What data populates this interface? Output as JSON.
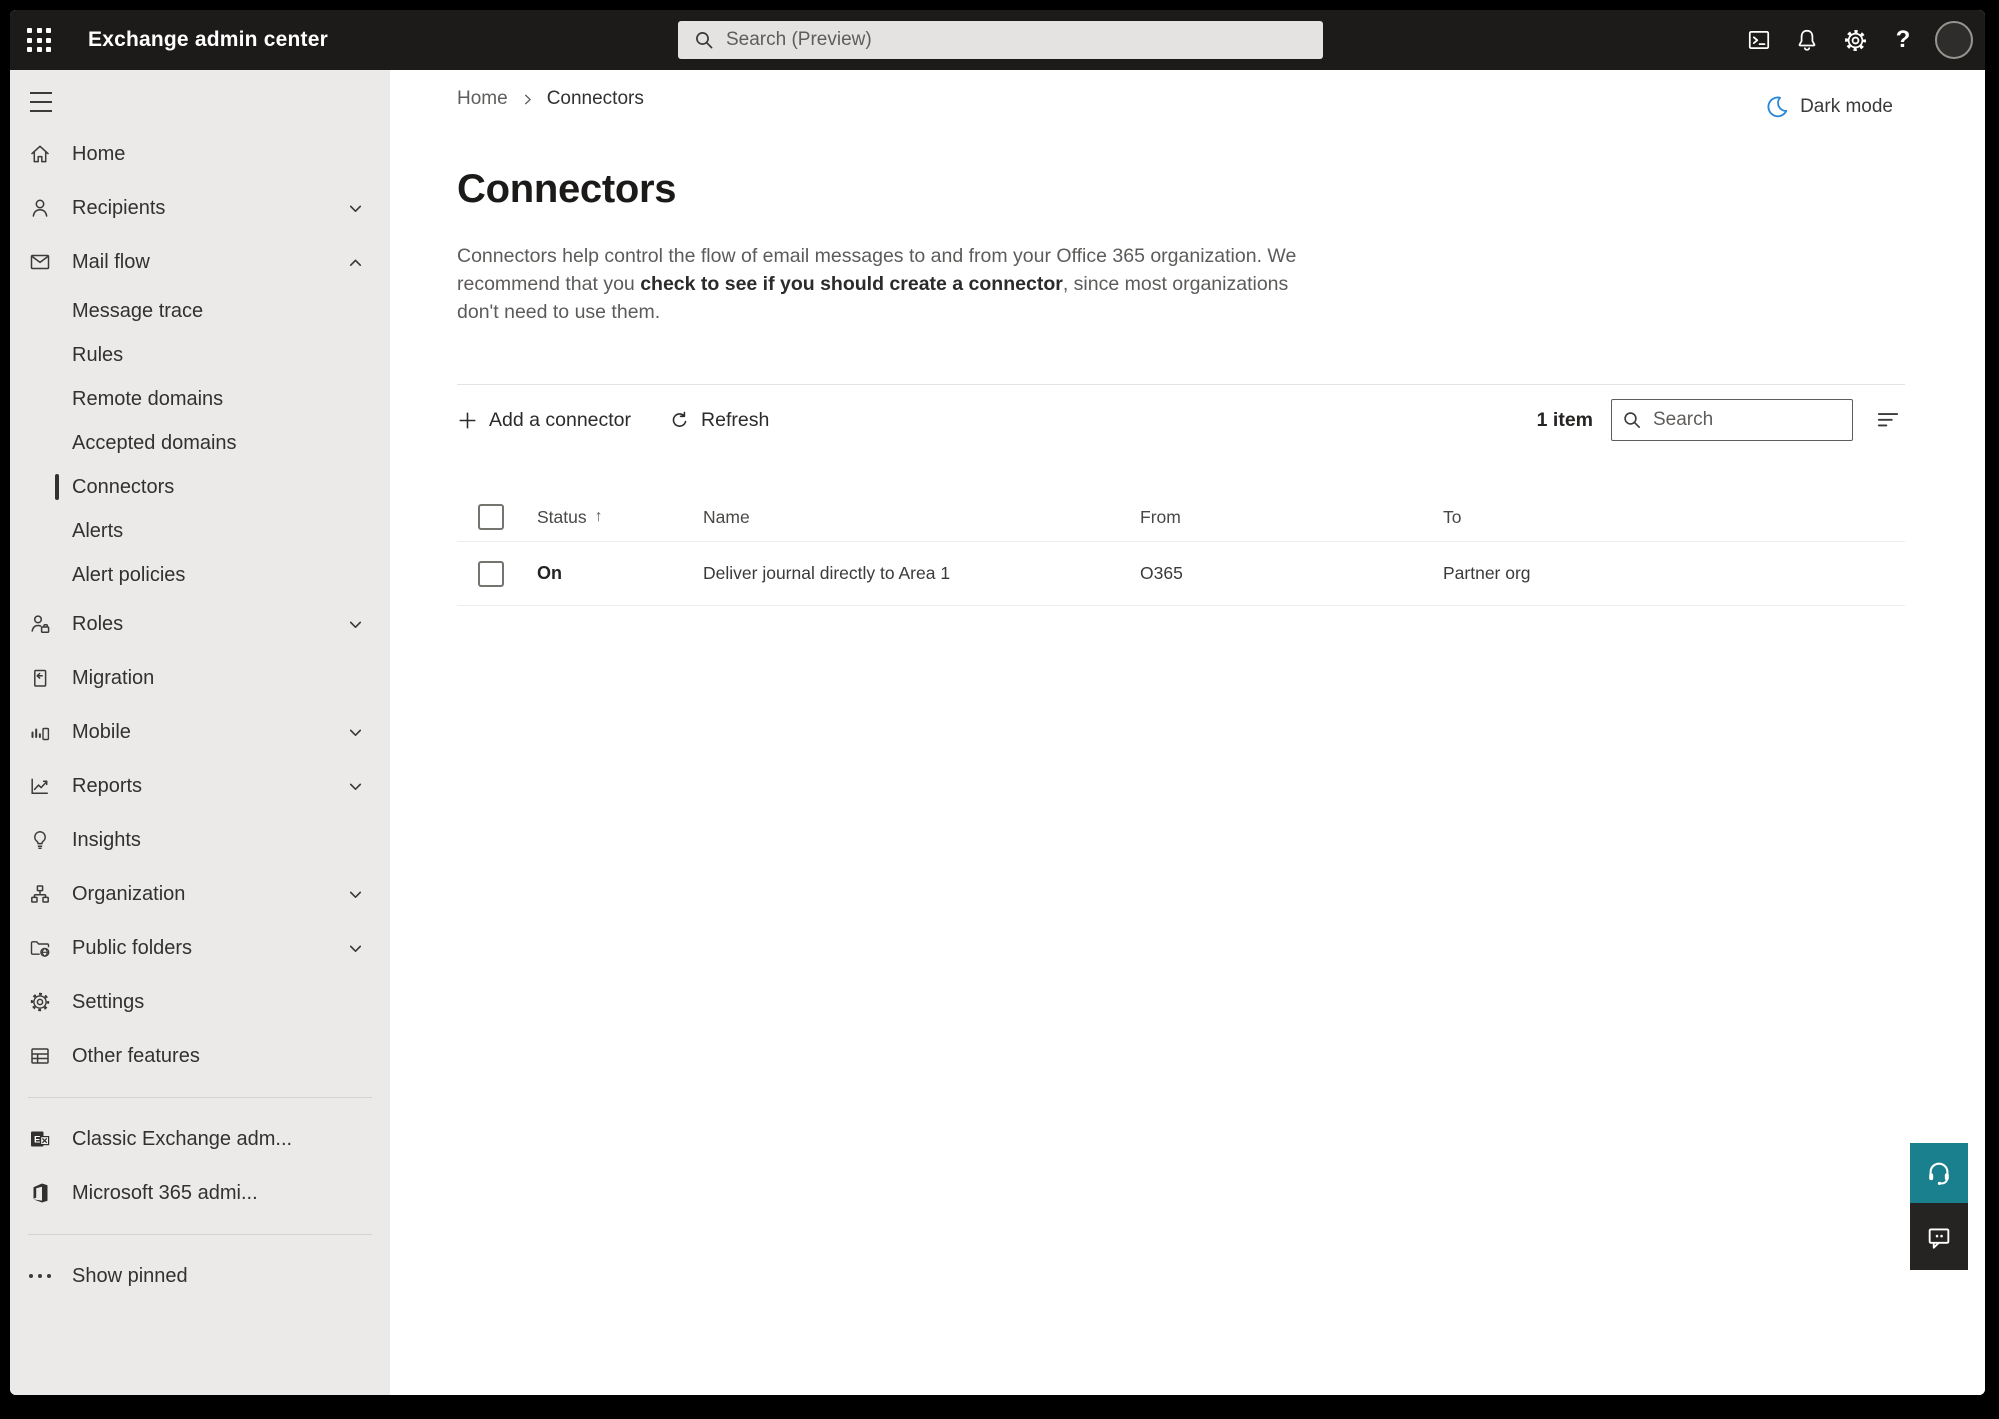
{
  "topbar": {
    "title": "Exchange admin center",
    "search_placeholder": "Search (Preview)"
  },
  "sidebar": {
    "items": [
      {
        "label": "Home"
      },
      {
        "label": "Recipients",
        "chevron": "down"
      },
      {
        "label": "Mail flow",
        "chevron": "up",
        "expanded": true
      },
      {
        "label": "Message trace"
      },
      {
        "label": "Rules"
      },
      {
        "label": "Remote domains"
      },
      {
        "label": "Accepted domains"
      },
      {
        "label": "Connectors",
        "selected": true
      },
      {
        "label": "Alerts"
      },
      {
        "label": "Alert policies"
      },
      {
        "label": "Roles",
        "chevron": "down"
      },
      {
        "label": "Migration"
      },
      {
        "label": "Mobile",
        "chevron": "down"
      },
      {
        "label": "Reports",
        "chevron": "down"
      },
      {
        "label": "Insights"
      },
      {
        "label": "Organization",
        "chevron": "down"
      },
      {
        "label": "Public folders",
        "chevron": "down"
      },
      {
        "label": "Settings"
      },
      {
        "label": "Other features"
      },
      {
        "label": "Classic Exchange adm..."
      },
      {
        "label": "Microsoft 365 admi..."
      },
      {
        "label": "Show pinned"
      }
    ]
  },
  "breadcrumb": {
    "home": "Home",
    "current": "Connectors"
  },
  "dark_mode": {
    "label": "Dark mode"
  },
  "page": {
    "title": "Connectors",
    "description_part1": "Connectors help control the flow of email messages to and from your Office 365 organization. We recommend that you ",
    "description_link": "check to see if you should create a connector",
    "description_part2": ", since most organizations don't need to use them."
  },
  "toolbar": {
    "add_connector_label": "Add a connector",
    "refresh_label": "Refresh",
    "item_count": "1 item",
    "search_placeholder": "Search"
  },
  "table": {
    "headers": {
      "status": "Status",
      "name": "Name",
      "from": "From",
      "to": "To"
    },
    "sort": {
      "column": "Status",
      "direction": "ascending",
      "indicator": "↑"
    },
    "rows": [
      {
        "status": "On",
        "name": "Deliver journal directly to Area 1",
        "from": "O365",
        "to": "Partner org"
      }
    ]
  },
  "colors": {
    "topbar_bg": "#1c1b1a",
    "sidebar_bg": "#eceae8",
    "dark_mode_icon_blue": "#2b88d8",
    "help_button_teal": "#1a808d",
    "feedback_button_dark": "#252423"
  }
}
